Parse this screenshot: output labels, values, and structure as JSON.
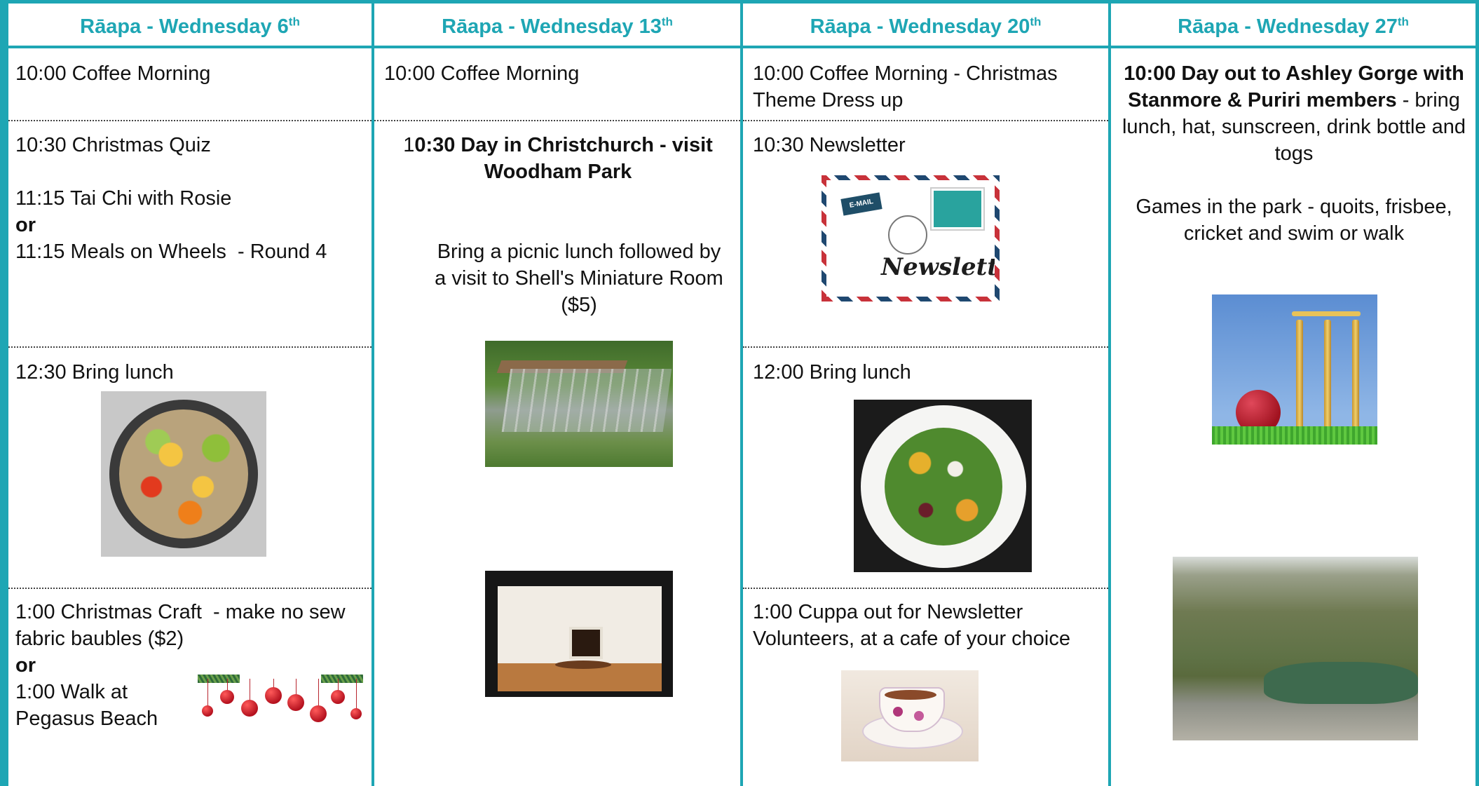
{
  "headers": [
    {
      "main": "Rāapa - Wednesday 6",
      "sup": "th"
    },
    {
      "main": "Rāapa - Wednesday 13",
      "sup": "th"
    },
    {
      "main": "Rāapa - Wednesday 20",
      "sup": "th"
    },
    {
      "main": "Rāapa - Wednesday 27",
      "sup": "th"
    }
  ],
  "col1": {
    "coffee": "10:00 Coffee Morning",
    "quiz": "10:30 Christmas Quiz",
    "taichi": "11:15 Tai Chi with Rosie",
    "or1": "or",
    "meals": "11:15 Meals on Wheels  - Round 4",
    "lunch": "12:30 Bring lunch",
    "craft": "1:00 Christmas Craft  - make no sew fabric baubles ($2)",
    "or2": "or",
    "walk": "1:00 Walk at Pegasus Beach"
  },
  "col2": {
    "coffee": "10:00 Coffee Morning",
    "trip_prefix": "1",
    "trip_bold": "0:30 Day in Christchurch - visit Woodham Park",
    "picnic": "Bring a picnic lunch followed by a visit to Shell's Miniature Room ($5)"
  },
  "col3": {
    "coffee": "10:00 Coffee Morning - Christmas Theme Dress up",
    "newsletter": "10:30 Newsletter",
    "newsletter_email_label": "E-MAIL",
    "newsletter_script": "Newsletter",
    "lunch": "12:00 Bring lunch",
    "cuppa": "1:00 Cuppa out for Newsletter Volunteers, at a cafe of your choice"
  },
  "col4": {
    "trip_bold": "10:00 Day out to Ashley Gorge with Stanmore & Puriri members",
    "trip_rest": " - bring lunch, hat, sunscreen, drink bottle and togs",
    "games": "Games in the park - quoits, frisbee, cricket and swim or walk"
  },
  "colors": {
    "accent": "#1ea6b4"
  }
}
